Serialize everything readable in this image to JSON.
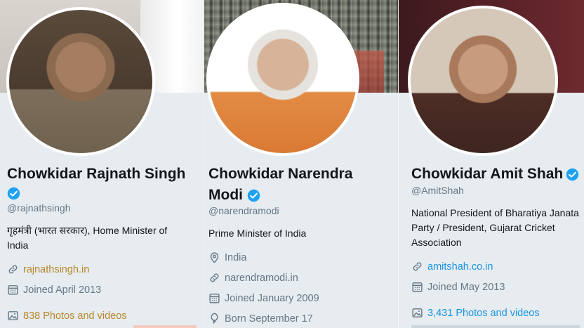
{
  "colors": {
    "background": "#e6ecf0",
    "name_text": "#14171a",
    "secondary_text": "#657786",
    "link_gold": "#b8872b",
    "link_blue": "#1b95e0",
    "verified_blue": "#1da1f2"
  },
  "profiles": [
    {
      "name": "Chowkidar Rajnath Singh",
      "handle": "@rajnathsingh",
      "bio_line1": "गृहमंत्री (भारत सरकार), Home Minister of",
      "bio_line2": "India",
      "website": "rajnathsingh.in",
      "joined": "Joined April 2013",
      "media": "838 Photos and videos",
      "icons": [
        "link-icon",
        "calendar-icon",
        "photo-icon"
      ]
    },
    {
      "name_line1": "Chowkidar Narendra",
      "name_line2": "Modi",
      "handle": "@narendramodi",
      "bio": "Prime Minister of India",
      "location": "India",
      "website": "narendramodi.in",
      "joined": "Joined January 2009",
      "born": "Born September 17",
      "icons": [
        "location-icon",
        "link-icon",
        "calendar-icon",
        "balloon-icon"
      ]
    },
    {
      "name": "Chowkidar Amit Shah",
      "handle": "@AmitShah",
      "bio_line1": "National President of Bharatiya Janata",
      "bio_line2": "Party / President, Gujarat Cricket",
      "bio_line3": "Association",
      "website": "amitshah.co.in",
      "joined": "Joined May 2013",
      "media": "3,431 Photos and videos",
      "icons": [
        "link-icon",
        "calendar-icon",
        "photo-icon"
      ]
    }
  ]
}
